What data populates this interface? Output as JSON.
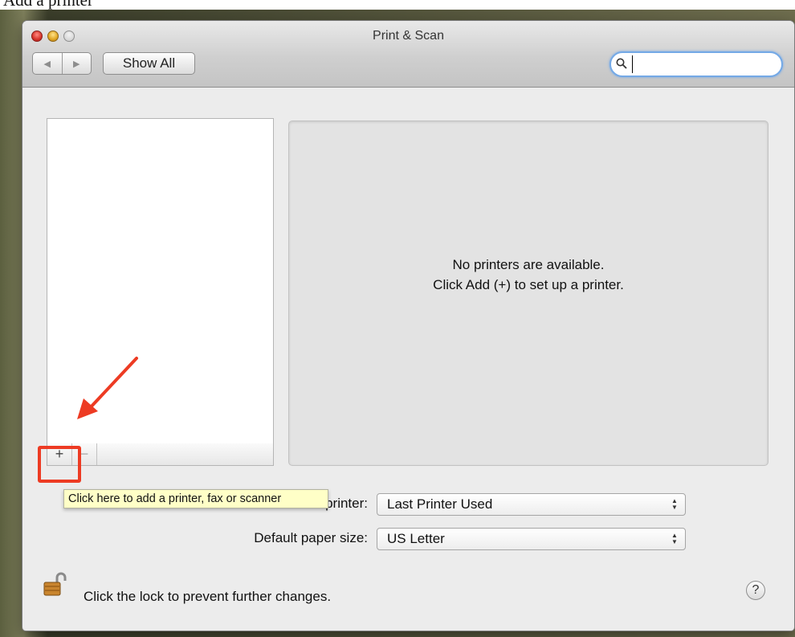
{
  "page_heading": "Add a printer",
  "window": {
    "title": "Print & Scan",
    "nav": {
      "back_icon": "◀",
      "forward_icon": "▶"
    },
    "show_all_label": "Show All",
    "search": {
      "value": "",
      "placeholder": ""
    }
  },
  "printer_list": {
    "items": [],
    "add_label": "+",
    "remove_label": "−"
  },
  "info_pane": {
    "line1": "No printers are available.",
    "line2": "Click Add (+) to set up a printer."
  },
  "settings": {
    "default_printer_label": "Default printer:",
    "default_printer_value": "Last Printer Used",
    "paper_size_label": "Default paper size:",
    "paper_size_value": "US Letter"
  },
  "tooltip": "Click here to add a printer, fax or scanner",
  "footer": {
    "lock_text": "Click the lock to prevent further changes.",
    "help_label": "?"
  },
  "annotation": {
    "color": "#ed3b23"
  }
}
